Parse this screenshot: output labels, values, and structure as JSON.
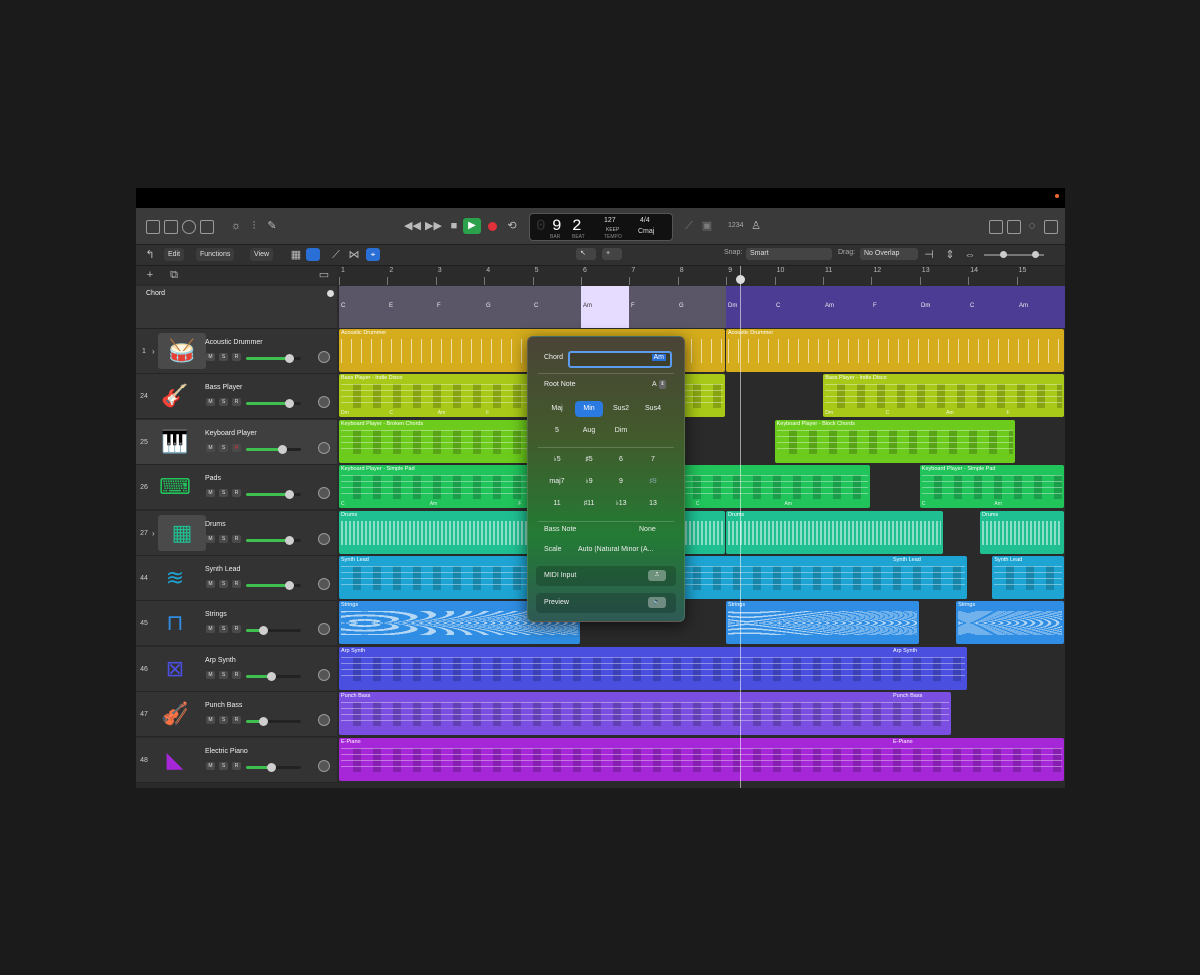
{
  "transport": {
    "bar": "9",
    "beat": "2",
    "bar_label": "BAR",
    "beat_label": "BEAT",
    "tempo": "127",
    "tempo_mode": "KEEP",
    "tempo_label": "TEMPO",
    "time_signature": "4/4",
    "key": "Cmaj",
    "counter": "1234"
  },
  "toolbar": {
    "edit": "Edit",
    "functions": "Functions",
    "view": "View",
    "snap_label": "Snap:",
    "snap_value": "Smart",
    "drag_label": "Drag:",
    "drag_value": "No Overlap"
  },
  "ruler": {
    "bars": [
      "1",
      "2",
      "3",
      "4",
      "5",
      "6",
      "7",
      "8",
      "9",
      "10",
      "11",
      "12",
      "13",
      "14",
      "15"
    ]
  },
  "chord_track": {
    "name": "Chord",
    "chords": [
      "C",
      "E",
      "F",
      "G",
      "C",
      "Am",
      "F",
      "G",
      "Dm",
      "C",
      "Am",
      "F",
      "Dm",
      "C",
      "Am"
    ]
  },
  "tracks": [
    {
      "num": "1",
      "name": "Acoustic Drummer",
      "icon": "drum-kit-icon",
      "color": "#d4ac1c",
      "fader": 0.78,
      "disclose": true
    },
    {
      "num": "24",
      "name": "Bass Player",
      "icon": "bass-guitar-icon",
      "color": "#a8c917",
      "fader": 0.78,
      "disclose": false
    },
    {
      "num": "25",
      "name": "Keyboard Player",
      "icon": "grand-piano-icon",
      "color": "#6ccb1c",
      "fader": 0.65,
      "disclose": false
    },
    {
      "num": "26",
      "name": "Pads",
      "icon": "keyboard-stand-icon",
      "color": "#21c35b",
      "fader": 0.78,
      "disclose": false
    },
    {
      "num": "27",
      "name": "Drums",
      "icon": "drum-machine-icon",
      "color": "#1fbf92",
      "fader": 0.78,
      "disclose": true
    },
    {
      "num": "44",
      "name": "Synth Lead",
      "icon": "waveform-icon",
      "color": "#1ea4d2",
      "fader": 0.78,
      "disclose": false
    },
    {
      "num": "45",
      "name": "Strings",
      "icon": "synth-stand-icon",
      "color": "#2f8ee3",
      "fader": 0.3,
      "disclose": false
    },
    {
      "num": "46",
      "name": "Arp Synth",
      "icon": "arp-synth-icon",
      "color": "#4b4fe0",
      "fader": 0.45,
      "disclose": false
    },
    {
      "num": "47",
      "name": "Punch Bass",
      "icon": "strings-section-icon",
      "color": "#7a4ee0",
      "fader": 0.3,
      "disclose": false
    },
    {
      "num": "48",
      "name": "Electric Piano",
      "icon": "bell-icon",
      "color": "#a527d8",
      "fader": 0.45,
      "disclose": false
    }
  ],
  "regions": [
    [
      {
        "name": "Acoustic Drummer",
        "start": 0,
        "end": 0.533
      },
      {
        "name": "Acoustic Drummer",
        "start": 0.533,
        "end": 1.0
      }
    ],
    [
      {
        "name": "Bass Player - Indie Disco",
        "start": 0,
        "end": 0.533,
        "chords": [
          "Dm",
          "C",
          "Am",
          "F",
          "Dm",
          "C",
          "Am",
          "F"
        ]
      },
      {
        "name": "Bass Player - Indie Disco",
        "start": 0.667,
        "end": 1.0,
        "chords": [
          "Dm",
          "C",
          "Am",
          "F"
        ]
      }
    ],
    [
      {
        "name": "Keyboard Player - Broken Chords",
        "start": 0,
        "end": 0.4
      },
      {
        "name": "Keyboard Player - Block Chords",
        "start": 0.6,
        "end": 0.933
      }
    ],
    [
      {
        "name": "Keyboard Player - Simple Pad",
        "start": 0,
        "end": 0.733,
        "chords": [
          "C",
          "Am",
          "F",
          "G",
          "C",
          "Am"
        ]
      },
      {
        "name": "Keyboard Player - Simple Pad",
        "start": 0.8,
        "end": 1.0,
        "chords": [
          "C",
          "Am"
        ]
      }
    ],
    [
      {
        "name": "Drums",
        "start": 0,
        "end": 0.533
      },
      {
        "name": "Drums",
        "start": 0.533,
        "end": 0.833
      },
      {
        "name": "Drums",
        "start": 0.883,
        "end": 1.0
      }
    ],
    [
      {
        "name": "Synth Lead",
        "start": 0,
        "end": 0.867
      },
      {
        "name": "Synth Lead",
        "start": 0.9,
        "end": 1.0
      }
    ],
    [
      {
        "name": "Strings",
        "start": 0,
        "end": 0.333
      },
      {
        "name": "Strings",
        "start": 0.533,
        "end": 0.8
      },
      {
        "name": "Strings",
        "start": 0.85,
        "end": 1.0
      }
    ],
    [
      {
        "name": "Arp Synth",
        "start": 0,
        "end": 0.867
      }
    ],
    [
      {
        "name": "Punch Bass",
        "start": 0,
        "end": 0.845
      }
    ],
    [
      {
        "name": "E-Piano",
        "start": 0,
        "end": 1.0
      }
    ]
  ],
  "region_secondary_labels": [
    "Synth Lead",
    "Arp Synth",
    "Punch Bass",
    "E-Piano"
  ],
  "chord_popup": {
    "chord_label": "Chord",
    "chord_value": "Am",
    "root_label": "Root Note",
    "root_value": "A",
    "qualities": [
      "Maj",
      "Min",
      "Sus2",
      "Sus4",
      "5",
      "Aug",
      "Dim"
    ],
    "active_quality": "Min",
    "extensions": [
      "♭5",
      "♯5",
      "6",
      "7",
      "maj7",
      "♭9",
      "9",
      "♯9",
      "11",
      "♯11",
      "♭13",
      "13"
    ],
    "disabled_extension": "♯9",
    "bass_label": "Bass Note",
    "bass_value": "None",
    "scale_label": "Scale",
    "scale_value": "Auto (Natural Minor (A...",
    "midi_label": "MIDI Input",
    "preview_label": "Preview"
  }
}
